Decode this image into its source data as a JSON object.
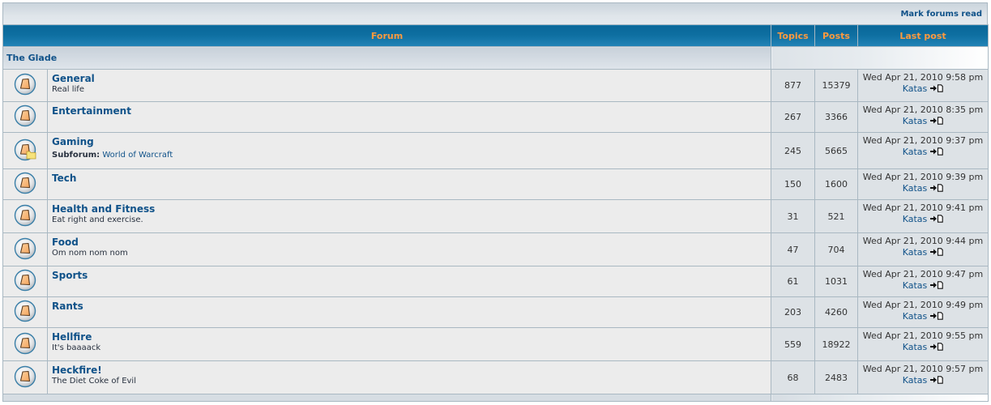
{
  "toolbar": {
    "mark_read_label": "Mark forums read"
  },
  "columns": {
    "forum": "Forum",
    "topics": "Topics",
    "posts": "Posts",
    "last_post": "Last post"
  },
  "category": {
    "name": "The Glade"
  },
  "subforum_label": "Subforum:",
  "colors": {
    "link": "#105289",
    "header_bg": "#0e6fa1",
    "header_text": "#ff9a3e",
    "row_bg": "#ececec",
    "stat_bg": "#dde2e6"
  },
  "forums": [
    {
      "name": "General",
      "description": "Real life",
      "topics": "877",
      "posts": "15379",
      "last_post_date": "Wed Apr 21, 2010 9:58 pm",
      "last_post_user": "Katas",
      "icon": "forum-read-icon"
    },
    {
      "name": "Entertainment",
      "description": "",
      "topics": "267",
      "posts": "3366",
      "last_post_date": "Wed Apr 21, 2010 8:35 pm",
      "last_post_user": "Katas",
      "icon": "forum-read-icon"
    },
    {
      "name": "Gaming",
      "description": "",
      "subforum": "World of Warcraft",
      "topics": "245",
      "posts": "5665",
      "last_post_date": "Wed Apr 21, 2010 9:37 pm",
      "last_post_user": "Katas",
      "icon": "forum-subforum-icon"
    },
    {
      "name": "Tech",
      "description": "",
      "topics": "150",
      "posts": "1600",
      "last_post_date": "Wed Apr 21, 2010 9:39 pm",
      "last_post_user": "Katas",
      "icon": "forum-read-icon"
    },
    {
      "name": "Health and Fitness",
      "description": "Eat right and exercise.",
      "topics": "31",
      "posts": "521",
      "last_post_date": "Wed Apr 21, 2010 9:41 pm",
      "last_post_user": "Katas",
      "icon": "forum-read-icon"
    },
    {
      "name": "Food",
      "description": "Om nom nom nom",
      "topics": "47",
      "posts": "704",
      "last_post_date": "Wed Apr 21, 2010 9:44 pm",
      "last_post_user": "Katas",
      "icon": "forum-read-icon"
    },
    {
      "name": "Sports",
      "description": "",
      "topics": "61",
      "posts": "1031",
      "last_post_date": "Wed Apr 21, 2010 9:47 pm",
      "last_post_user": "Katas",
      "icon": "forum-read-icon"
    },
    {
      "name": "Rants",
      "description": "",
      "topics": "203",
      "posts": "4260",
      "last_post_date": "Wed Apr 21, 2010 9:49 pm",
      "last_post_user": "Katas",
      "icon": "forum-read-icon"
    },
    {
      "name": "Hellfire",
      "description": "It's baaaack",
      "topics": "559",
      "posts": "18922",
      "last_post_date": "Wed Apr 21, 2010 9:55 pm",
      "last_post_user": "Katas",
      "icon": "forum-read-icon"
    },
    {
      "name": "Heckfire!",
      "description": "The Diet Coke of Evil",
      "topics": "68",
      "posts": "2483",
      "last_post_date": "Wed Apr 21, 2010 9:57 pm",
      "last_post_user": "Katas",
      "icon": "forum-read-icon"
    }
  ]
}
